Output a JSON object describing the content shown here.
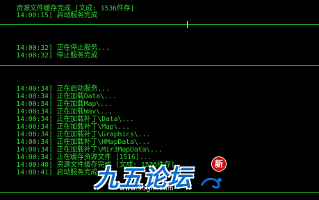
{
  "console": {
    "lines": [
      {
        "ts": "",
        "text": "资源文件缓存完成 [文成: 1536件存]"
      },
      {
        "ts": "14:00:15]",
        "text": "启动服务完成"
      },
      {
        "ts": "14:00:32]",
        "text": "正在停止服务..."
      },
      {
        "ts": "14:00:32]",
        "text": "停止服务完成"
      },
      {
        "ts": "14:00:34]",
        "text": "正在启动服务..."
      },
      {
        "ts": "14:00:34]",
        "text": "正在加载Data\\..."
      },
      {
        "ts": "14:00:34]",
        "text": "正在加载Map\\..."
      },
      {
        "ts": "14:00:34]",
        "text": "正在加载Wav\\..."
      },
      {
        "ts": "14:00:34]",
        "text": "正在加载补丁\\Data\\..."
      },
      {
        "ts": "14:00:34]",
        "text": "正在加载补丁\\Map\\..."
      },
      {
        "ts": "14:00:34]",
        "text": "正在加载补丁\\Graphics\\..."
      },
      {
        "ts": "14:00:34]",
        "text": "正在加载补丁\\HMapData\\..."
      },
      {
        "ts": "14:00:34]",
        "text": "正在加载补丁\\Mir3MapData\\..."
      },
      {
        "ts": "14:00:34]",
        "text": "正在缓存资源文件 [1516]..."
      },
      {
        "ts": "14:00:40]",
        "text": "资源文件缓存完成 [文成: 1536件存]"
      },
      {
        "ts": "14:00:41]",
        "text": "启动服务完成"
      }
    ]
  },
  "watermark": {
    "title": "九五论坛",
    "url": "www.95gm.com",
    "badge": "新"
  },
  "colors": {
    "background": "#000000",
    "text": "#2fd62f",
    "separator": "#1fa81f",
    "watermark_blue": "#0a6fd0",
    "badge_red": "#d01010"
  }
}
